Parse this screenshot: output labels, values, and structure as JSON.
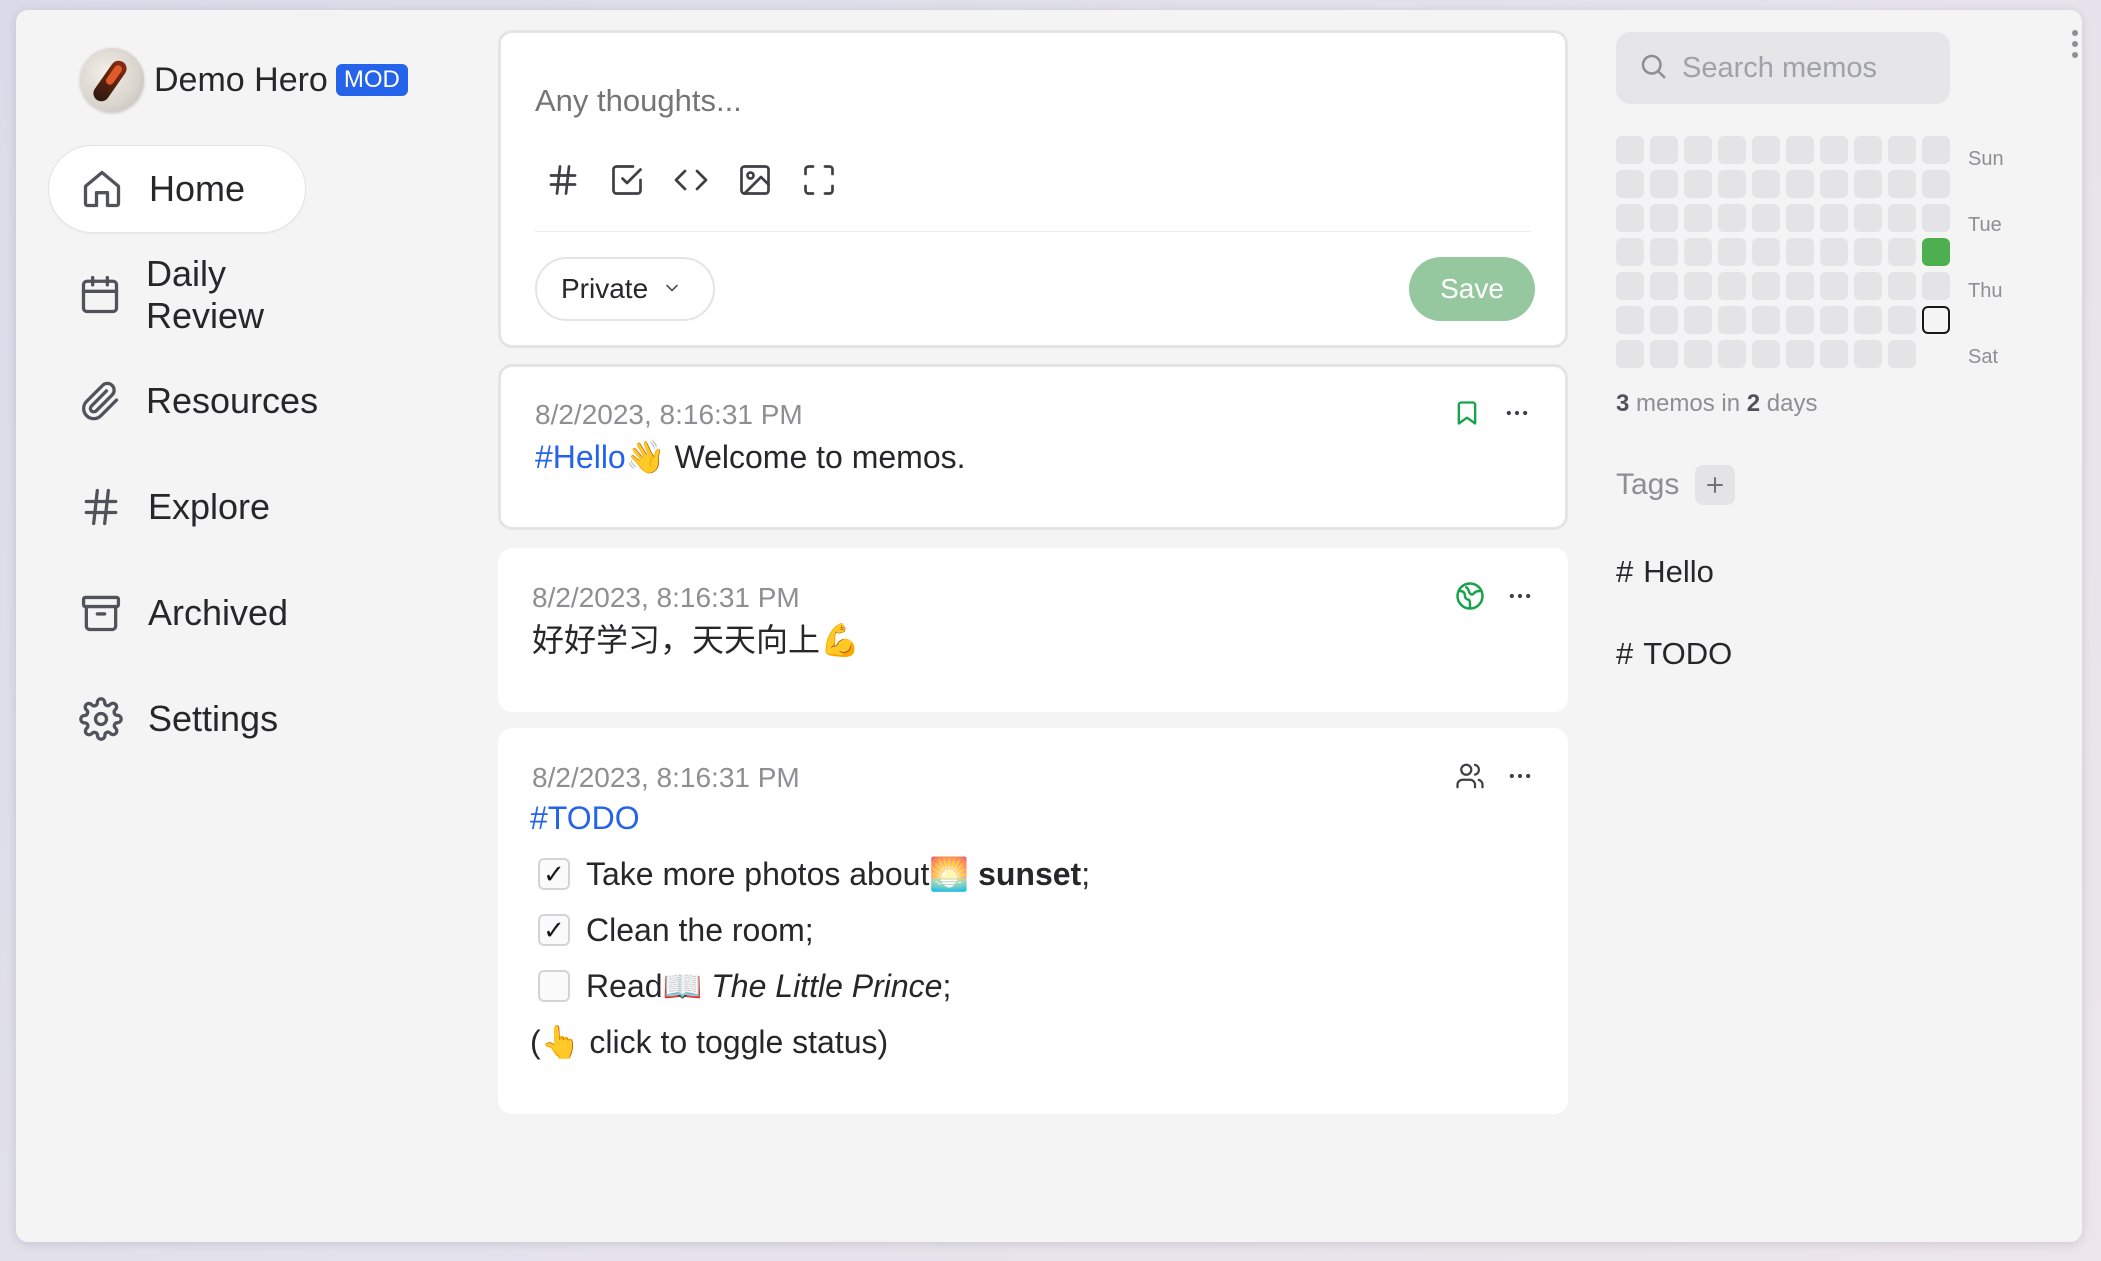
{
  "brand": {
    "name": "Demo Hero",
    "badge": "MOD"
  },
  "nav": [
    {
      "label": "Home",
      "icon": "home-icon",
      "active": true
    },
    {
      "label": "Daily Review",
      "icon": "calendar-icon"
    },
    {
      "label": "Resources",
      "icon": "paperclip-icon"
    },
    {
      "label": "Explore",
      "icon": "hash-icon"
    },
    {
      "label": "Archived",
      "icon": "archive-icon"
    },
    {
      "label": "Settings",
      "icon": "gear-icon"
    }
  ],
  "editor": {
    "placeholder": "Any thoughts...",
    "visibility": "Private",
    "save_label": "Save"
  },
  "memos": [
    {
      "time": "8/2/2023, 8:16:31 PM",
      "tag": "#Hello",
      "emoji": "👋",
      "text": " Welcome to memos.",
      "status_icon": "bookmark-icon"
    },
    {
      "time": "8/2/2023, 8:16:31 PM",
      "text": "好好学习，天天向上💪",
      "status_icon": "globe-icon"
    },
    {
      "time": "8/2/2023, 8:16:31 PM",
      "tag": "#TODO",
      "status_icon": "users-icon",
      "todos": [
        {
          "checked": true,
          "pre": "Take more photos about ",
          "emoji": "🌅",
          "bold": "sunset",
          "post": ";"
        },
        {
          "checked": true,
          "pre": "Clean the room;"
        },
        {
          "checked": false,
          "pre": "Read ",
          "emoji": "📖",
          "italic": "The Little Prince",
          "post": ";"
        }
      ],
      "footer": "(👆 click to toggle status)"
    }
  ],
  "search": {
    "placeholder": "Search memos"
  },
  "heatmap": {
    "days": [
      "Sun",
      "Tue",
      "Thu",
      "Sat"
    ],
    "filled_color": "#4caf50"
  },
  "stats": {
    "memos": "3",
    "memos_text": " memos in ",
    "days": "2",
    "days_text": " days"
  },
  "tags": {
    "label": "Tags",
    "items": [
      "Hello",
      "TODO"
    ]
  }
}
